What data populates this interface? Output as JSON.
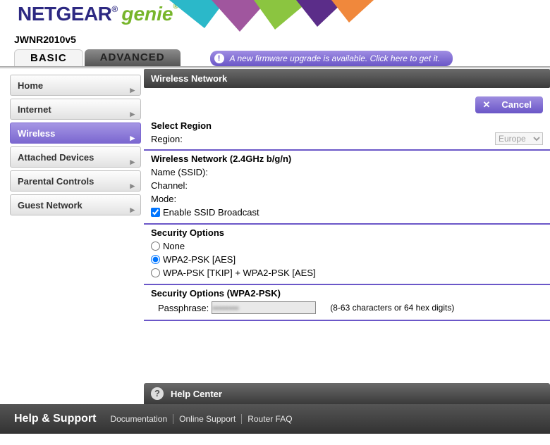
{
  "header": {
    "brand": "NETGEAR",
    "product": "genie",
    "model": "JWNR2010v5"
  },
  "tabs": {
    "basic": "BASIC",
    "advanced": "ADVANCED"
  },
  "firmware_notice": "A new firmware upgrade is available. Click here to get it.",
  "sidebar": {
    "items": [
      {
        "label": "Home"
      },
      {
        "label": "Internet"
      },
      {
        "label": "Wireless"
      },
      {
        "label": "Attached Devices"
      },
      {
        "label": "Parental Controls"
      },
      {
        "label": "Guest Network"
      }
    ]
  },
  "panel": {
    "title": "Wireless Network",
    "cancel_label": "Cancel",
    "region": {
      "heading": "Select Region",
      "label": "Region:",
      "value": "Europe"
    },
    "wl24": {
      "heading": "Wireless Network (2.4GHz b/g/n)",
      "ssid_label": "Name (SSID):",
      "channel_label": "Channel:",
      "mode_label": "Mode:",
      "broadcast_label": "Enable SSID Broadcast",
      "broadcast_checked": true
    },
    "security": {
      "heading": "Security Options",
      "options": [
        {
          "label": "None",
          "selected": false
        },
        {
          "label": "WPA2-PSK [AES]",
          "selected": true
        },
        {
          "label": "WPA-PSK [TKIP] + WPA2-PSK [AES]",
          "selected": false
        }
      ]
    },
    "passphrase": {
      "heading": "Security Options (WPA2-PSK)",
      "label": "Passphrase:",
      "value": "",
      "hint": "(8-63 characters or 64 hex digits)"
    }
  },
  "help_center": "Help Center",
  "footer": {
    "title": "Help & Support",
    "links": [
      "Documentation",
      "Online Support",
      "Router FAQ"
    ]
  }
}
